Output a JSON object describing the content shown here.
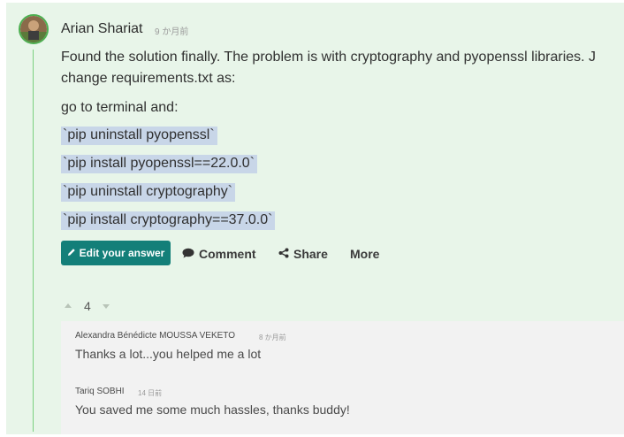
{
  "answer": {
    "author": "Arian Shariat",
    "time": "9 か月前",
    "body_lines": [
      "Found the solution finally. The problem is with cryptography and pyopenssl libraries. J",
      "change requirements.txt as:",
      "go to terminal and:"
    ],
    "code_lines": [
      "`pip uninstall pyopenssl`",
      "`pip install pyopenssl==22.0.0`",
      "`pip uninstall cryptography`",
      "`pip install cryptography==37.0.0`"
    ]
  },
  "actions": {
    "edit_label": "Edit your answer",
    "comment_label": "Comment",
    "share_label": "Share",
    "more_label": "More"
  },
  "votes": {
    "count": "4"
  },
  "comments": [
    {
      "author": "Alexandra Bénédicte MOUSSA VEKETO",
      "time": "8 か月前",
      "text": "Thanks a lot...you helped me a lot"
    },
    {
      "author": "Tariq SOBHI",
      "time": "14 日前",
      "text": "You saved me some much hassles, thanks buddy!"
    }
  ],
  "colors": {
    "panel_bg": "#e8f5e9",
    "accent_green": "#4caf50",
    "edit_button": "#137f79",
    "code_highlight": "#c8d6e8"
  }
}
